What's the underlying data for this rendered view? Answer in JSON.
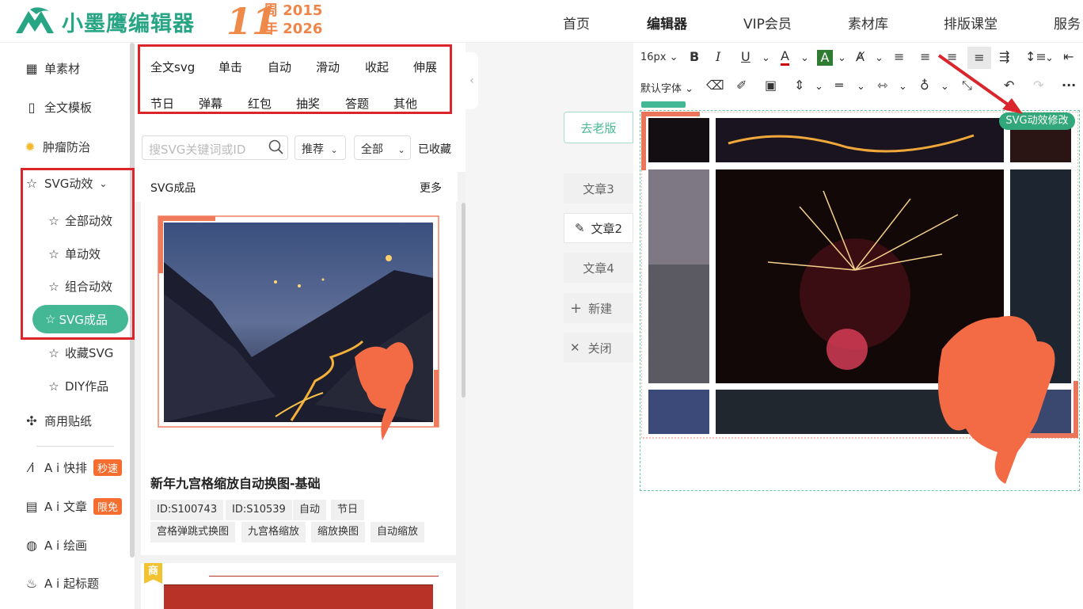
{
  "header": {
    "logo_text": "小墨鹰编辑器",
    "anniversary_number": "11",
    "anniversary_label_1": "周",
    "anniversary_label_2": "年",
    "anniversary_year_start": "2015",
    "anniversary_year_end": "2026",
    "nav": [
      "首页",
      "编辑器",
      "VIP会员",
      "素材库",
      "排版课堂",
      "服务"
    ]
  },
  "sidebar": {
    "items": [
      {
        "label": "单素材",
        "icon": "grid-icon"
      },
      {
        "label": "全文模板",
        "icon": "template-icon"
      },
      {
        "label": "肿瘤防治",
        "icon": "sun-icon"
      },
      {
        "label": "SVG动效",
        "icon": "star-icon"
      },
      {
        "label": "商用贴纸",
        "icon": "puzzle-icon"
      },
      {
        "label": "A i 快排",
        "badge": "秒速",
        "icon": "ai-icon"
      },
      {
        "label": "A i 文章",
        "badge": "限免",
        "icon": "document-icon"
      },
      {
        "label": "A i 绘画",
        "icon": "palette-icon"
      },
      {
        "label": "A i 起标题",
        "icon": "flame-icon"
      }
    ],
    "svg_sub": [
      "全部动效",
      "单动效",
      "组合动效",
      "SVG成品",
      "收藏SVG",
      "DIY作品"
    ]
  },
  "middle": {
    "categories_row1": [
      "全文svg",
      "单击",
      "自动",
      "滑动",
      "收起",
      "伸展"
    ],
    "categories_row2": [
      "节日",
      "弹幕",
      "红包",
      "抽奖",
      "答题",
      "其他"
    ],
    "search_placeholder": "搜SVG关键词或ID",
    "sort_option": "推荐",
    "filter_option": "全部",
    "favorited": "已收藏",
    "section_title": "SVG成品",
    "more": "更多",
    "card": {
      "title": "新年九宫格缩放自动换图-基础",
      "tags_row1": [
        "ID:S100743",
        "ID:S10539",
        "自动",
        "节日"
      ],
      "tags_row2": [
        "宫格弹跳式换图",
        "九宫格缩放",
        "缩放换图",
        "自动缩放"
      ]
    },
    "card2_badge": "商"
  },
  "articles": {
    "old_version": "去老版",
    "items": [
      "文章3",
      "文章2",
      "文章4"
    ],
    "new": "新建",
    "close": "关闭"
  },
  "editor": {
    "font_size": "16px",
    "font_family": "默认字体",
    "svg_edit_tag": "SVG动效修改"
  },
  "colors": {
    "brand": "#27a584",
    "accent_green": "#44b895",
    "highlight_red": "#d9252b",
    "horse_orange": "#f26b45"
  }
}
